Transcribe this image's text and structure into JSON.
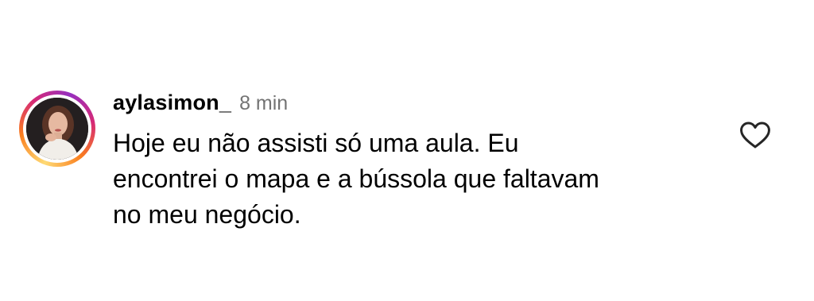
{
  "comment": {
    "username": "aylasimon_",
    "time": "8 min",
    "text_lines": [
      "Hoje eu não assisti só uma aula. Eu",
      "encontrei o mapa e a bússola que faltavam",
      "no meu negócio."
    ],
    "avatar": {
      "icon": "profile-photo",
      "has_story_ring": true
    },
    "like_icon": "heart-outline-icon"
  },
  "colors": {
    "username": "#000000",
    "time": "#737373",
    "text": "#000000",
    "ring_start": "#feda75",
    "ring_mid": "#d62976",
    "ring_end": "#962fbf",
    "like_icon": "#262626"
  }
}
